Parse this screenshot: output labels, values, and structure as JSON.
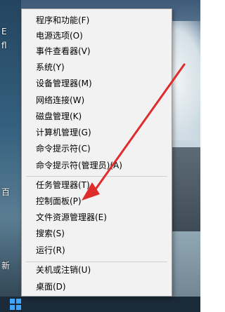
{
  "desktop": {
    "edge_texts": [
      "E",
      "fl",
      "百",
      "新"
    ]
  },
  "menu": {
    "groups": [
      {
        "items": [
          "程序和功能(F)",
          "电源选项(O)",
          "事件查看器(V)",
          "系统(Y)",
          "设备管理器(M)",
          "网络连接(W)",
          "磁盘管理(K)",
          "计算机管理(G)",
          "命令提示符(C)",
          "命令提示符(管理员)(A)"
        ]
      },
      {
        "items": [
          "任务管理器(T)",
          "控制面板(P)",
          "文件资源管理器(E)",
          "搜索(S)",
          "运行(R)"
        ]
      },
      {
        "items": [
          "关机或注销(U)",
          "桌面(D)"
        ]
      }
    ]
  },
  "annotation": {
    "arrow_color": "#e02b2b",
    "points_to": "控制面板(P)"
  },
  "taskbar": {
    "start_icon": "windows-logo-icon",
    "start_color": "#3ea6ff"
  }
}
